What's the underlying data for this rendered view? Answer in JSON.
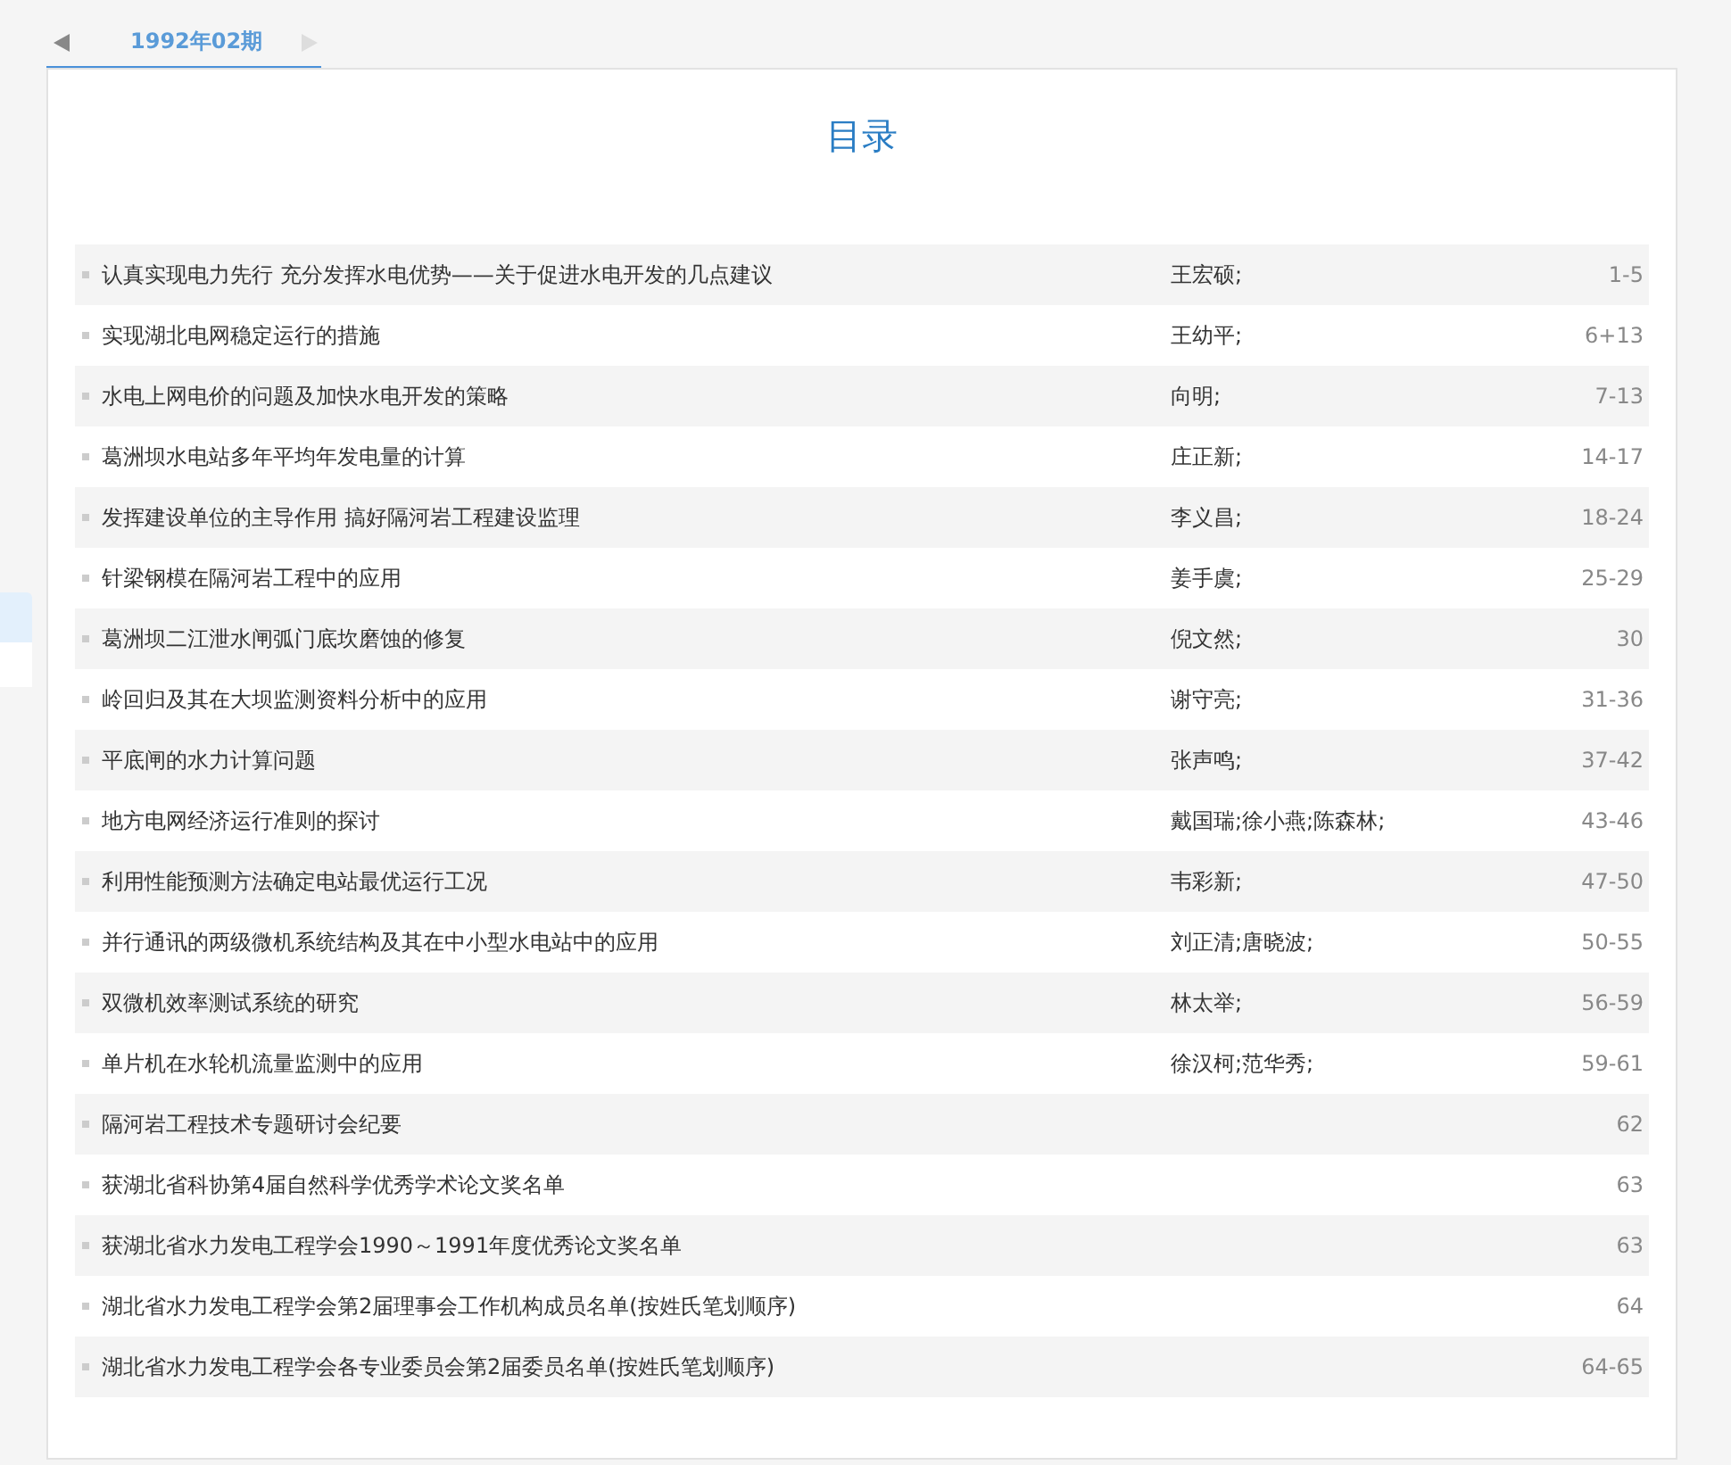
{
  "tab_bar": {
    "prev_arrow": {
      "disabled": false
    },
    "tab": {
      "label": "1992年02期",
      "selected": true
    },
    "next_arrow": {
      "disabled": true
    }
  },
  "heading": "目录",
  "articles": [
    {
      "title": "认真实现电力先行 充分发挥水电优势——关于促进水电开发的几点建议",
      "authors": "王宏硕;",
      "pages": "1-5"
    },
    {
      "title": "实现湖北电网稳定运行的措施",
      "authors": "王幼平;",
      "pages": "6+13"
    },
    {
      "title": "水电上网电价的问题及加快水电开发的策略",
      "authors": "向明;",
      "pages": "7-13"
    },
    {
      "title": "葛洲坝水电站多年平均年发电量的计算",
      "authors": "庄正新;",
      "pages": "14-17"
    },
    {
      "title": "发挥建设单位的主导作用 搞好隔河岩工程建设监理",
      "authors": "李义昌;",
      "pages": "18-24"
    },
    {
      "title": "针梁钢模在隔河岩工程中的应用",
      "authors": "姜手虞;",
      "pages": "25-29"
    },
    {
      "title": "葛洲坝二江泄水闸弧门底坎磨蚀的修复",
      "authors": "倪文然;",
      "pages": "30"
    },
    {
      "title": "岭回归及其在大坝监测资料分析中的应用",
      "authors": "谢守亮;",
      "pages": "31-36"
    },
    {
      "title": "平底闸的水力计算问题",
      "authors": "张声鸣;",
      "pages": "37-42"
    },
    {
      "title": "地方电网经济运行准则的探讨",
      "authors": "戴国瑞;徐小燕;陈森林;",
      "pages": "43-46"
    },
    {
      "title": "利用性能预测方法确定电站最优运行工况",
      "authors": "韦彩新;",
      "pages": "47-50"
    },
    {
      "title": "并行通讯的两级微机系统结构及其在中小型水电站中的应用",
      "authors": "刘正清;唐晓波;",
      "pages": "50-55"
    },
    {
      "title": "双微机效率测试系统的研究",
      "authors": "林太举;",
      "pages": "56-59"
    },
    {
      "title": "单片机在水轮机流量监测中的应用",
      "authors": "徐汉柯;范华秀;",
      "pages": "59-61"
    },
    {
      "title": "隔河岩工程技术专题研讨会纪要",
      "pages": "62"
    },
    {
      "title": "获湖北省科协第4届自然科学优秀学术论文奖名单",
      "pages": "63"
    },
    {
      "title": "获湖北省水力发电工程学会1990～1991年度优秀论文奖名单",
      "pages": "63"
    },
    {
      "title": "湖北省水力发电工程学会第2届理事会工作机构成员名单(按姓氏笔划顺序)",
      "pages": "64"
    },
    {
      "title": "湖北省水力发电工程学会各专业委员会第2届委员名单(按姓氏笔划顺序)",
      "pages": "64-65"
    }
  ]
}
